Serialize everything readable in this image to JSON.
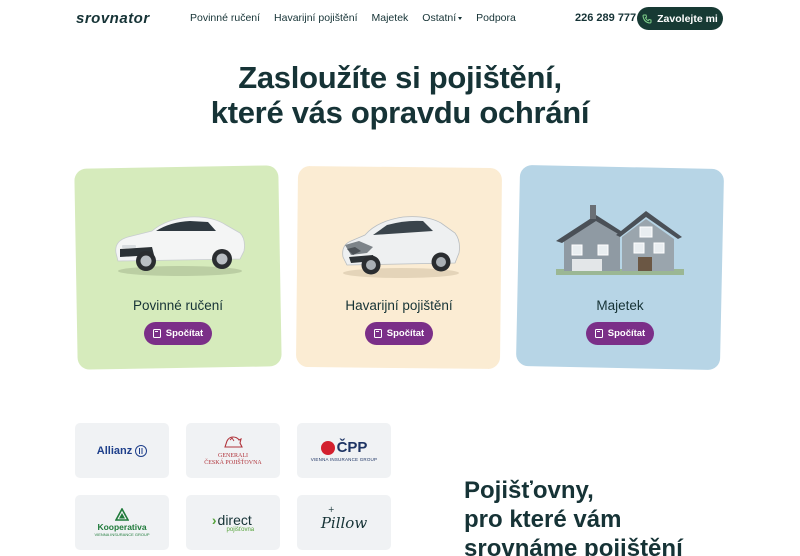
{
  "header": {
    "logo_text": "srovnator",
    "nav": [
      {
        "label": "Povinné ručení"
      },
      {
        "label": "Havarijní pojištění"
      },
      {
        "label": "Majetek"
      },
      {
        "label": "Ostatní",
        "dropdown": true
      },
      {
        "label": "Podpora"
      }
    ],
    "phone": "226 289 777",
    "call_button": "Zavolejte mi",
    "call_icon": "phone-icon"
  },
  "hero": {
    "title_line1": "Zasloužíte si pojištění,",
    "title_line2": "které vás opravdu ochrání"
  },
  "products": [
    {
      "label": "Povinné ručení",
      "button": "Spočítat",
      "image": "white-car-image",
      "color": "#d6ebbc"
    },
    {
      "label": "Havarijní pojištění",
      "button": "Spočítat",
      "image": "crashed-car-image",
      "color": "#fbecd3"
    },
    {
      "label": "Majetek",
      "button": "Spočítat",
      "image": "house-image",
      "color": "#b7d5e6"
    }
  ],
  "insurers": {
    "logos": [
      {
        "name": "Allianz"
      },
      {
        "name": "Generali Česká pojišťovna",
        "line1": "GENERALI",
        "line2": "ČESKÁ POJIŠŤOVNA"
      },
      {
        "name": "ČPP",
        "text": "ČPP",
        "sub": "VIENNA INSURANCE GROUP"
      },
      {
        "name": "Kooperativa",
        "text": "Kooperativa",
        "sub": "VIENNA INSURANCE GROUP"
      },
      {
        "name": "Direct pojišťovna",
        "text": "direct",
        "sub": "pojišťovna"
      },
      {
        "name": "Pillow",
        "text": "Pillow"
      }
    ],
    "title_line1": "Pojišťovny,",
    "title_line2": "pro které vám",
    "title_line3": "srovnáme pojištění"
  },
  "colors": {
    "primary_dark": "#163336",
    "button_purple": "#7b2f88",
    "call_button_bg": "#173a34"
  }
}
